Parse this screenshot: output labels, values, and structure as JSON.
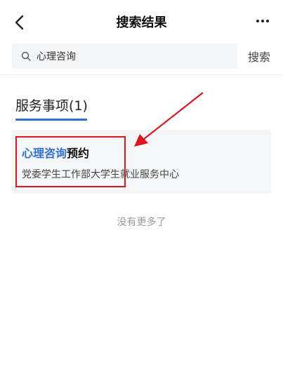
{
  "navbar": {
    "title": "搜索结果"
  },
  "search": {
    "query": "心理咨询",
    "button_label": "搜索"
  },
  "section": {
    "title": "服务事项(1)"
  },
  "results": [
    {
      "title_highlight": "心理咨询",
      "title_rest": "预约",
      "department": "党委学生工作部大学生就业服务中心"
    }
  ],
  "footer": {
    "no_more": "没有更多了"
  },
  "colors": {
    "accent": "#2f6fd4",
    "annotation": "#e0161c"
  }
}
